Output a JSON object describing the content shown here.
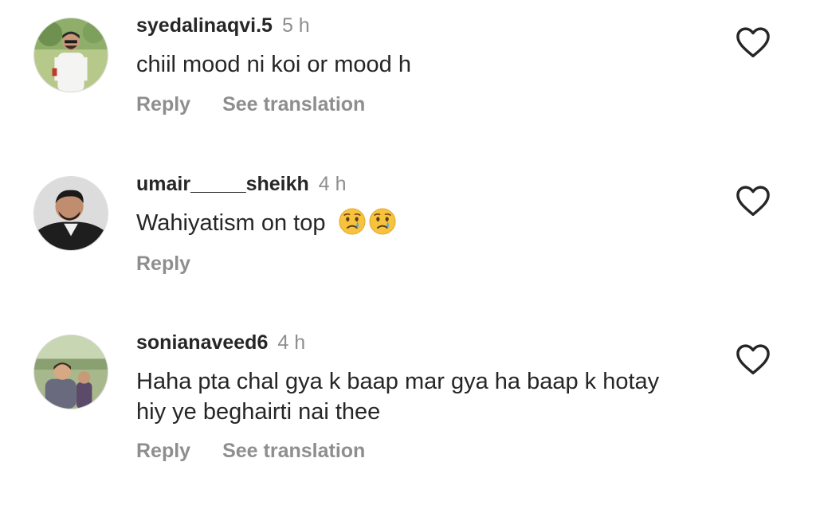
{
  "comments": [
    {
      "username": "syedalinaqvi.5",
      "time": "5 h",
      "text": "chiil  mood ni koi or mood h",
      "reply_label": "Reply",
      "translate_label": "See translation"
    },
    {
      "username": "umair_____sheikh",
      "time": "4 h",
      "text": "Wahiyatism on top",
      "emojis": [
        "crying-face-emoji",
        "crying-face-emoji"
      ],
      "reply_label": "Reply"
    },
    {
      "username": "sonianaveed6",
      "time": "4 h",
      "text_line1": "Haha pta chal gya k baap mar gya ha  baap k hotay",
      "text_line2": "hiy ye beghairti nai thee",
      "reply_label": "Reply",
      "translate_label": "See translation"
    }
  ],
  "colors": {
    "primary_text": "#262626",
    "secondary_text": "#8e8e8e",
    "background": "#ffffff"
  }
}
